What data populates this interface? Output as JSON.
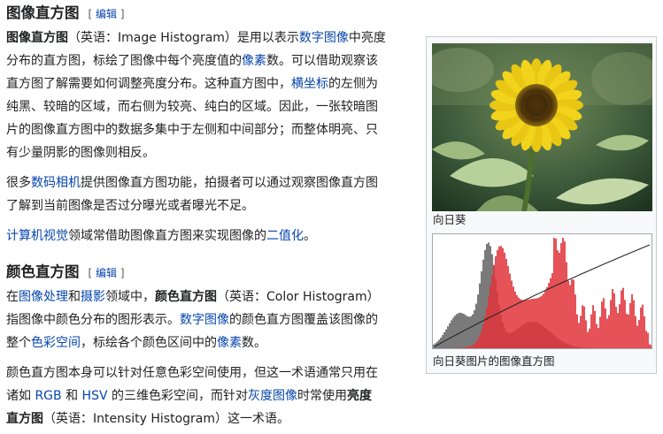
{
  "section1": {
    "heading": "图像直方图",
    "edit_open": "[",
    "edit_label": "编辑",
    "edit_close": "]",
    "p1": {
      "l1a": "图像直方图",
      "l1b": "（英语：Image Histogram）是用以表示",
      "l1c": "数字图像",
      "l1d": "中亮度",
      "l2a": "分布的直方图，标绘了图像中每个亮度值的",
      "l2b": "像素",
      "l2c": "数。可以借助观察该",
      "l3a": "直方图了解需要如何调整亮度分布。这种直方图中，",
      "l3b": "横坐标",
      "l3c": "的左侧为",
      "l4": "纯黑、较暗的区域，而右侧为较亮、纯白的区域。因此，一张较暗图",
      "l5": "片的图像直方图中的数据多集中于左侧和中间部分；而整体明亮、只",
      "l6": "有少量阴影的图像则相反。"
    },
    "p2": {
      "l1a": "很多",
      "l1b": "数码相机",
      "l1c": "提供图像直方图功能，拍摄者可以通过观察图像直方图",
      "l2": "了解到当前图像是否过分曝光或者曝光不足。"
    },
    "p3": {
      "l1a": "计算机视觉",
      "l1b": "领域常借助图像直方图来实现图像的",
      "l1c": "二值化",
      "l1d": "。"
    }
  },
  "section2": {
    "heading": "颜色直方图",
    "edit_open": "[",
    "edit_label": "编辑",
    "edit_close": "]",
    "p1": {
      "l1a": "在",
      "l1b": "图像处理",
      "l1c": "和",
      "l1d": "摄影",
      "l1e": "领域中，",
      "l1f": "颜色直方图",
      "l1g": "（英语：Color Histogram）",
      "l2a": "指图像中颜色分布的图形表示。",
      "l2b": "数字图像",
      "l2c": "的颜色直方图覆盖该图像的",
      "l3a": "整个",
      "l3b": "色彩空间",
      "l3c": "，标绘各个颜色区间中的",
      "l3d": "像素",
      "l3e": "数。"
    },
    "p2": {
      "l1": "颜色直方图本身可以针对任意色彩空间使用，但这一术语通常只用在",
      "l2a": "诸如 ",
      "l2b": "RGB",
      "l2c": " 和 ",
      "l2d": "HSV",
      "l2e": " 的三维色彩空间，而针对",
      "l2f": "灰度图像",
      "l2g": "时常使用",
      "l2h": "亮度",
      "l3a": "直方图",
      "l3b": "（英语：Intensity Histogram）这一术语。"
    }
  },
  "thumb": {
    "caption1": "向日葵",
    "caption2": "向日葵图片的图像直方图"
  },
  "colors": {
    "link": "#0645ad",
    "text": "#202122",
    "hist_red": "#e0343a",
    "hist_gray": "#7a7a7a",
    "petal": "#f2d31b"
  }
}
